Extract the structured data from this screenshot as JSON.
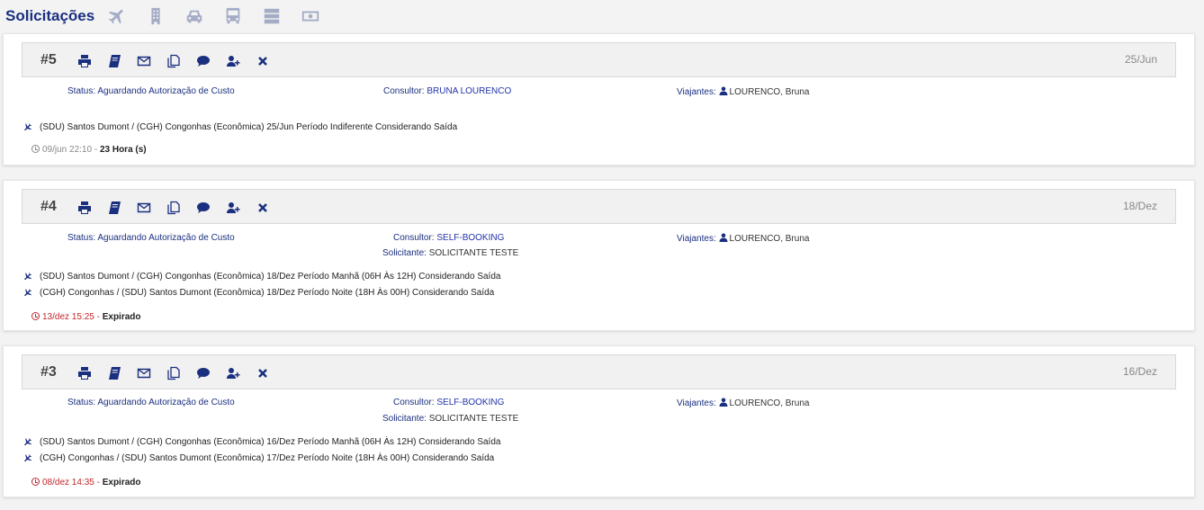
{
  "header": {
    "title": "Solicitações",
    "categories": [
      "plane-icon",
      "hotel-icon",
      "car-icon",
      "bus-icon",
      "server-icon",
      "money-icon"
    ]
  },
  "labels": {
    "status": "Status:",
    "consultor": "Consultor:",
    "solicitante": "Solicitante:",
    "viajantes": "Viajantes:"
  },
  "requests": [
    {
      "id": "#5",
      "date": "25/Jun",
      "status": "Aguardando Autorização de Custo",
      "consultor": "BRUNA LOURENCO",
      "solicitante": "",
      "viajantes": "LOURENCO, Bruna",
      "legs": [
        "(SDU) Santos Dumont / (CGH) Congonhas (Econômica) 25/Jun Período Indiferente Considerando Saída"
      ],
      "timer_date": "09/jun 22:10",
      "timer_sep": " - ",
      "timer_status": "23 Hora (s)"
    },
    {
      "id": "#4",
      "date": "18/Dez",
      "status": "Aguardando Autorização de Custo",
      "consultor": "SELF-BOOKING",
      "solicitante": "SOLICITANTE TESTE",
      "viajantes": "LOURENCO, Bruna",
      "legs": [
        "(SDU) Santos Dumont / (CGH) Congonhas (Econômica) 18/Dez Período Manhã (06H Às 12H) Considerando Saída",
        "(CGH) Congonhas / (SDU) Santos Dumont (Econômica) 18/Dez Período Noite (18H Às 00H) Considerando Saída"
      ],
      "timer_date": "13/dez 15:25",
      "timer_sep": " - ",
      "timer_status": "Expirado"
    },
    {
      "id": "#3",
      "date": "16/Dez",
      "status": "Aguardando Autorização de Custo",
      "consultor": "SELF-BOOKING",
      "solicitante": "SOLICITANTE TESTE",
      "viajantes": "LOURENCO, Bruna",
      "legs": [
        "(SDU) Santos Dumont / (CGH) Congonhas (Econômica) 16/Dez Período Manhã (06H Às 12H) Considerando Saída",
        "(CGH) Congonhas / (SDU) Santos Dumont (Econômica) 17/Dez Período Noite (18H Às 00H) Considerando Saída"
      ],
      "timer_date": "08/dez 14:35",
      "timer_sep": " - ",
      "timer_status": "Expirado"
    }
  ],
  "actions": [
    "print-icon",
    "book-icon",
    "envelope-icon",
    "copy-icon",
    "comment-icon",
    "add-user-icon",
    "close-icon"
  ],
  "colors": {
    "brand": "#1a2f80",
    "icon_muted": "#a4acc6",
    "expired": "#c0282d"
  }
}
